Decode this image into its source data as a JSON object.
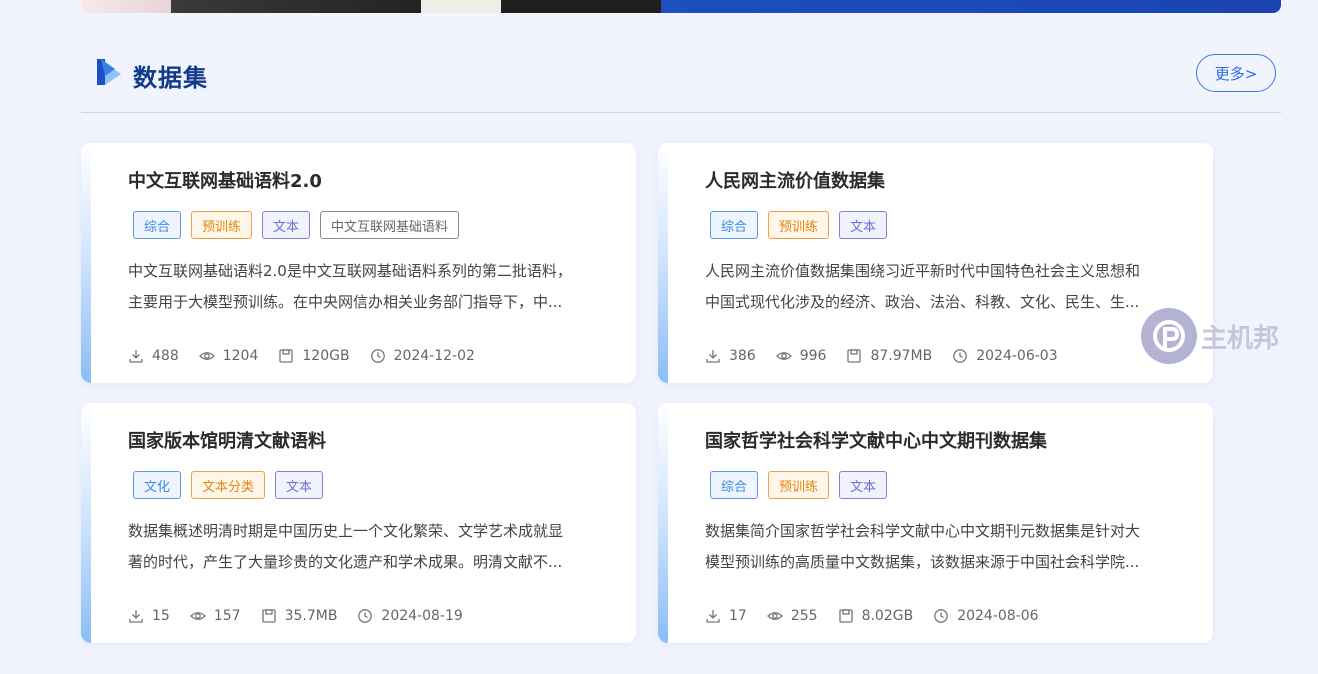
{
  "section": {
    "title": "数据集",
    "more_label": "更多>"
  },
  "datasets": [
    {
      "title": "中文互联网基础语料2.0",
      "tags": [
        {
          "label": "综合",
          "color": "#3f8ae0"
        },
        {
          "label": "预训练",
          "color": "#e6860f"
        },
        {
          "label": "文本",
          "color": "#6a6fd1"
        },
        {
          "label": "中文互联网基础语料",
          "color": "#666666"
        }
      ],
      "desc_line1": "中文互联网基础语料2.0是中文互联网基础语料系列的第二批语料，",
      "desc_line2": "主要用于大模型预训练。在中央网信办相关业务部门指导下，中...",
      "downloads": "488",
      "views": "1204",
      "size": "120GB",
      "date": "2024-12-02"
    },
    {
      "title": "人民网主流价值数据集",
      "tags": [
        {
          "label": "综合",
          "color": "#3f8ae0"
        },
        {
          "label": "预训练",
          "color": "#e6860f"
        },
        {
          "label": "文本",
          "color": "#6a6fd1"
        }
      ],
      "desc_line1": "人民网主流价值数据集围绕习近平新时代中国特色社会主义思想和",
      "desc_line2": "中国式现代化涉及的经济、政治、法治、科教、文化、民生、生...",
      "downloads": "386",
      "views": "996",
      "size": "87.97MB",
      "date": "2024-06-03"
    },
    {
      "title": "国家版本馆明清文献语料",
      "tags": [
        {
          "label": "文化",
          "color": "#3f8ae0"
        },
        {
          "label": "文本分类",
          "color": "#e6860f"
        },
        {
          "label": "文本",
          "color": "#6a6fd1"
        }
      ],
      "desc_line1": "数据集概述明清时期是中国历史上一个文化繁荣、文学艺术成就显",
      "desc_line2": "著的时代，产生了大量珍贵的文化遗产和学术成果。明清文献不...",
      "downloads": "15",
      "views": "157",
      "size": "35.7MB",
      "date": "2024-08-19"
    },
    {
      "title": "国家哲学社会科学文献中心中文期刊数据集",
      "tags": [
        {
          "label": "综合",
          "color": "#3f8ae0"
        },
        {
          "label": "预训练",
          "color": "#e6860f"
        },
        {
          "label": "文本",
          "color": "#6a6fd1"
        }
      ],
      "desc_line1": "数据集简介国家哲学社会科学文献中心中文期刊元数据集是针对大",
      "desc_line2": "模型预训练的高质量中文数据集，该数据来源于中国社会科学院...",
      "downloads": "17",
      "views": "255",
      "size": "8.02GB",
      "date": "2024-08-06"
    }
  ],
  "icons": {
    "download": "download-icon",
    "views": "eye-icon",
    "size": "save-icon",
    "date": "clock-icon"
  },
  "watermark": {
    "text": "主机邦"
  }
}
